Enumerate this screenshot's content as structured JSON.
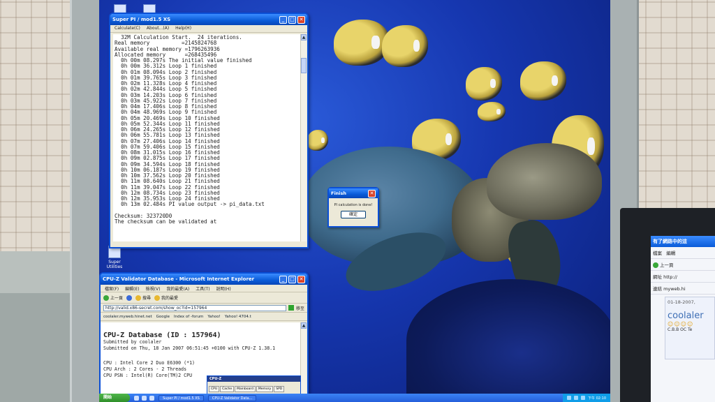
{
  "superpi": {
    "title": "Super PI / mod1.5 XS",
    "menu": [
      "Calculate(C)",
      "About...(A)",
      "Help(H)"
    ],
    "lines": [
      "  32M Calculation Start.  24 iterations.",
      "Real memory          =2145824768",
      "Available real memory =1796263936",
      "Allocated memory      =268435496",
      "  0h 00m 08.297s The initial value finished",
      "  0h 00m 36.312s Loop 1 finished",
      "  0h 01m 08.094s Loop 2 finished",
      "  0h 01m 39.765s Loop 3 finished",
      "  0h 02m 11.328s Loop 4 finished",
      "  0h 02m 42.844s Loop 5 finished",
      "  0h 03m 14.203s Loop 6 finished",
      "  0h 03m 45.922s Loop 7 finished",
      "  0h 04m 17.406s Loop 8 finished",
      "  0h 04m 48.969s Loop 9 finished",
      "  0h 05m 20.469s Loop 10 finished",
      "  0h 05m 52.344s Loop 11 finished",
      "  0h 06m 24.265s Loop 12 finished",
      "  0h 06m 55.781s Loop 13 finished",
      "  0h 07m 27.406s Loop 14 finished",
      "  0h 07m 59.406s Loop 15 finished",
      "  0h 08m 31.015s Loop 16 finished",
      "  0h 09m 02.875s Loop 17 finished",
      "  0h 09m 34.594s Loop 18 finished",
      "  0h 10m 06.187s Loop 19 finished",
      "  0h 10m 37.562s Loop 20 finished",
      "  0h 11m 08.640s Loop 21 finished",
      "  0h 11m 39.047s Loop 22 finished",
      "  0h 12m 08.734s Loop 23 finished",
      "  0h 12m 35.953s Loop 24 finished",
      "  0h 13m 02.484s PI value output -> pi_data.txt",
      "",
      "Checksum: 323720D0",
      "The checksum can be validated at"
    ]
  },
  "finish_dialog": {
    "title": "Finish",
    "message": "PI calculation is done!",
    "ok_label": "確定"
  },
  "desktop": {
    "icon_label": "Super Utilities"
  },
  "ie": {
    "title": "CPU-Z Validator Database - Microsoft Internet Explorer",
    "menu": [
      "檔案(F)",
      "編輯(E)",
      "檢視(V)",
      "我的最愛(A)",
      "工具(T)",
      "說明(H)"
    ],
    "toolbar": {
      "back": "上一頁",
      "search": "搜尋",
      "favorites": "我的最愛"
    },
    "address": "http://valid.x86-secret.com/show_oc?id=157964",
    "go_label": "移至",
    "links": [
      "coolaler.myweb.hinet.net",
      "Google",
      "Index of -forum",
      "Yahoo!",
      "Yahoo! 4704.t"
    ],
    "page": {
      "heading": "CPU-Z Database (ID : 157964)",
      "submitted_by": "Submitted by coolaler",
      "submitted_on": "Submitted on Thu, 18 Jan 2007 06:51:45 +0100 with CPU-Z 1.38.1",
      "cpu": "CPU : Intel Core 2 Duo E6300 (*1)",
      "arch": "CPU Arch : 2 Cores - 2 Threads",
      "psn": "CPU PSN : Intel(R) Core(TM)2 CPU"
    }
  },
  "cpuz": {
    "title": "CPU-Z",
    "tabs": [
      "CPU",
      "Cache",
      "Mainboard",
      "Memory",
      "SPD"
    ]
  },
  "taskbar": {
    "start": "開始",
    "tasks": [
      "Super PI / mod1.5 XS",
      "CPU-Z Validator Data..."
    ],
    "clock": "下午 02:10"
  },
  "monitor2": {
    "title": "有了網路中的這",
    "menu": [
      "檔案",
      "編輯"
    ],
    "back": "上一頁",
    "address_label": "網址",
    "address": "http://",
    "link_label": "連結",
    "link": "myweb.hi",
    "date": "01-18-2007,",
    "username": "coolaler",
    "team": "C.B.B OC Te"
  }
}
